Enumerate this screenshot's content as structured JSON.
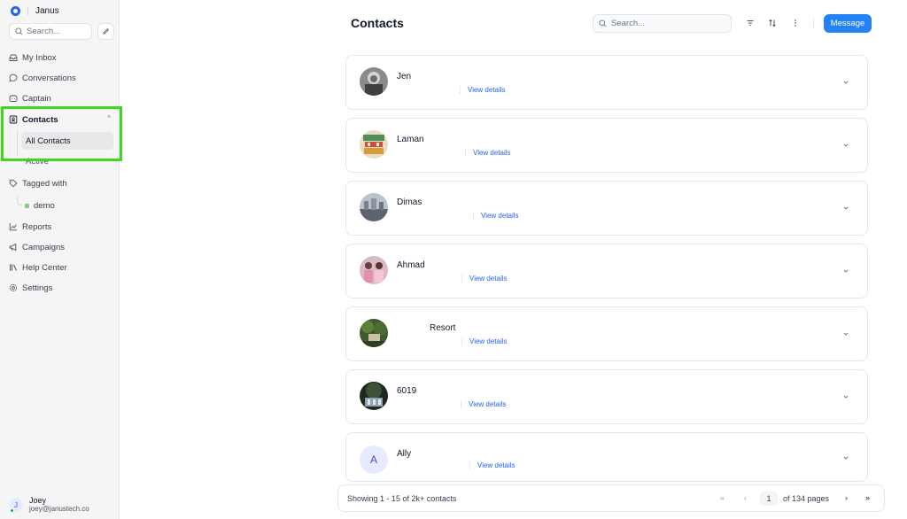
{
  "brand": {
    "name": "Janus"
  },
  "sidebar": {
    "search_placeholder": "Search...",
    "items": {
      "inbox": "My Inbox",
      "conversations": "Conversations",
      "captain": "Captain",
      "contacts": "Contacts",
      "all_contacts": "All Contacts",
      "active": "Active",
      "tagged_with": "Tagged with",
      "demo": "demo",
      "reports": "Reports",
      "campaigns": "Campaigns",
      "help_center": "Help Center",
      "settings": "Settings"
    },
    "user": {
      "initial": "J",
      "name": "Joey",
      "email": "joey@janustech.co"
    }
  },
  "header": {
    "title": "Contacts",
    "search_placeholder": "Search...",
    "message_button": "Message"
  },
  "contacts": [
    {
      "name": "Jen",
      "link": "View details",
      "avatar": "photo-gray"
    },
    {
      "name": "Laman",
      "link": "View details",
      "avatar": "photo-colorful"
    },
    {
      "name": "Dimas",
      "link": "View details",
      "avatar": "photo-city"
    },
    {
      "name": "Ahmad",
      "link": "View details",
      "avatar": "photo-people"
    },
    {
      "name": "Resort",
      "link": "View details",
      "avatar": "photo-green"
    },
    {
      "name": "6019",
      "link": "View details",
      "avatar": "photo-dark"
    },
    {
      "name": "Ally",
      "link": "View details",
      "avatar_letter": "A"
    }
  ],
  "footer": {
    "summary": "Showing 1 - 15 of 2k+ contacts",
    "current_page": "1",
    "total_pages": "of 134 pages"
  },
  "colors": {
    "accent": "#2582f4",
    "highlight": "#3fd61f"
  }
}
